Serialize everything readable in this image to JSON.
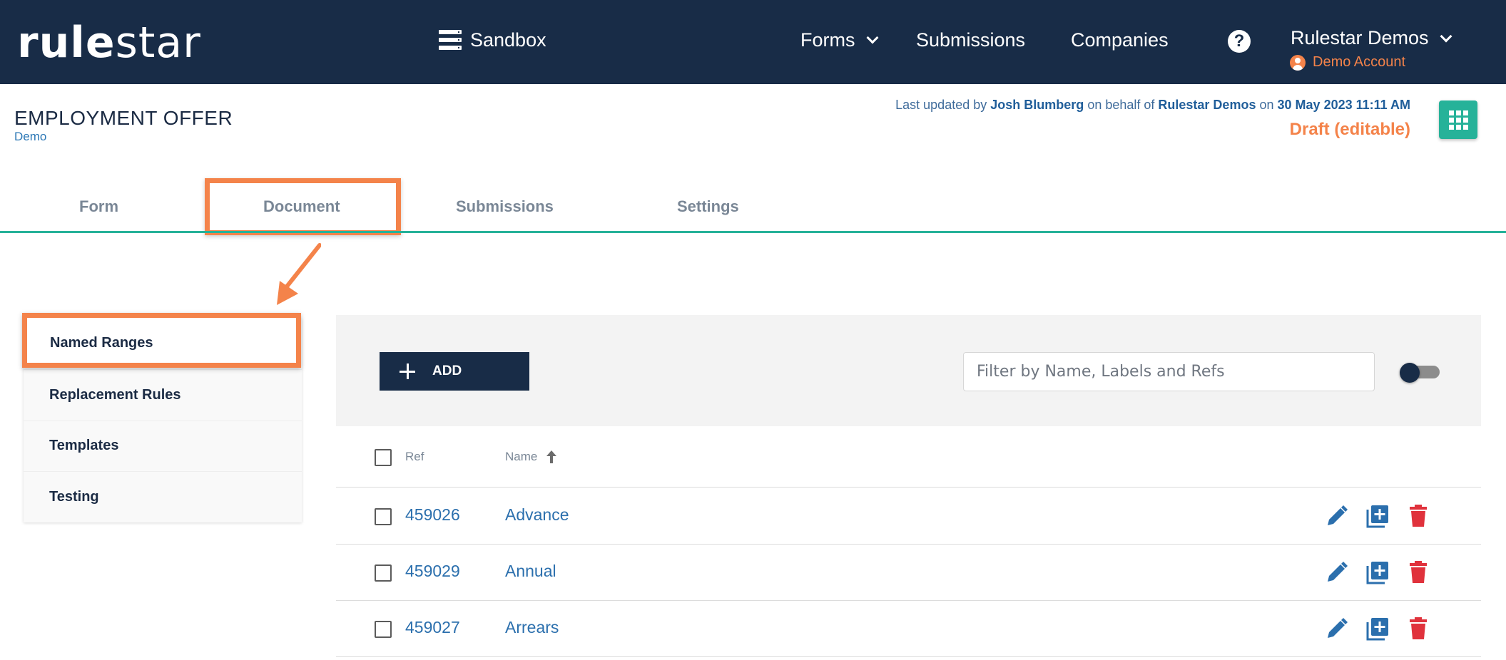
{
  "header": {
    "logo_bold": "rule",
    "logo_light": "star",
    "sandbox_label": "Sandbox",
    "nav": {
      "forms": "Forms",
      "submissions": "Submissions",
      "companies": "Companies"
    },
    "help": "?",
    "user_name": "Rulestar Demos",
    "account_label": "Demo Account"
  },
  "page": {
    "title": "EMPLOYMENT OFFER",
    "subtitle": "Demo",
    "last_updated": {
      "prefix": "Last updated by",
      "user": "Josh Blumberg",
      "middle": "on behalf of",
      "org": "Rulestar Demos",
      "on": "on",
      "date": "30 May 2023 11:11 AM"
    },
    "status": "Draft (editable)"
  },
  "tabs": [
    {
      "label": "Form"
    },
    {
      "label": "Document"
    },
    {
      "label": "Submissions"
    },
    {
      "label": "Settings"
    }
  ],
  "side_menu": [
    {
      "label": "Named Ranges"
    },
    {
      "label": "Replacement Rules"
    },
    {
      "label": "Templates"
    },
    {
      "label": "Testing"
    }
  ],
  "toolbar": {
    "add_label": "ADD",
    "filter_placeholder": "Filter by Name, Labels and Refs"
  },
  "table": {
    "col_ref": "Ref",
    "col_name": "Name",
    "rows": [
      {
        "ref": "459026",
        "name": "Advance"
      },
      {
        "ref": "459029",
        "name": "Annual"
      },
      {
        "ref": "459027",
        "name": "Arrears"
      }
    ]
  },
  "colors": {
    "navbar": "#182c47",
    "accent_teal": "#26b299",
    "highlight_orange": "#f4834a",
    "link_blue": "#2b6fad",
    "delete_red": "#e0323c"
  }
}
